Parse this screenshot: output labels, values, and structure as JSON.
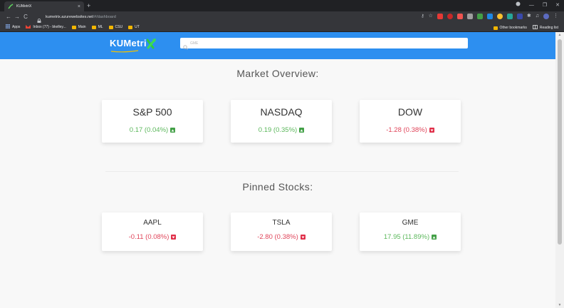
{
  "browser": {
    "tab_title": "KUMetriX",
    "tab_close": "×",
    "new_tab": "+",
    "window_controls": [
      "—",
      "❐",
      "✕"
    ],
    "nav": {
      "back": "←",
      "forward": "→",
      "reload": "C"
    },
    "url_host": "kumetrix.azurewebsites.net",
    "url_path": "/#/dashboard",
    "bookmarks": [
      {
        "label": "Apps",
        "icon": "apps-grid-icon"
      },
      {
        "label": "Inbox (77) - bkelley...",
        "icon": "gmail-icon"
      },
      {
        "label": "Main",
        "icon": "folder-icon"
      },
      {
        "label": "ML",
        "icon": "folder-icon"
      },
      {
        "label": "CSU",
        "icon": "folder-icon"
      },
      {
        "label": "UT",
        "icon": "folder-icon"
      }
    ],
    "bookmarks_right": [
      {
        "label": "Other bookmarks",
        "icon": "folder-icon"
      },
      {
        "label": "Reading list",
        "icon": "reading-list-icon"
      }
    ]
  },
  "app": {
    "logo_text": "KUMetri",
    "logo_accent": "X",
    "search_value": "",
    "search_placeholder": "GME",
    "colors": {
      "brand": "#2d8ff0",
      "up": "#5cb85c",
      "down": "#e0455a"
    }
  },
  "market_overview": {
    "title": "Market Overview:",
    "cards": [
      {
        "name": "S&P 500",
        "change": "0.17 (0.04%)",
        "direction": "up"
      },
      {
        "name": "NASDAQ",
        "change": "0.19 (0.35%)",
        "direction": "up"
      },
      {
        "name": "DOW",
        "change": "-1.28 (0.38%)",
        "direction": "down"
      }
    ]
  },
  "pinned": {
    "title": "Pinned Stocks:",
    "cards": [
      {
        "name": "AAPL",
        "change": "-0.11 (0.08%)",
        "direction": "down"
      },
      {
        "name": "TSLA",
        "change": "-2.80 (0.38%)",
        "direction": "down"
      },
      {
        "name": "GME",
        "change": "17.95 (11.89%)",
        "direction": "up"
      }
    ]
  }
}
